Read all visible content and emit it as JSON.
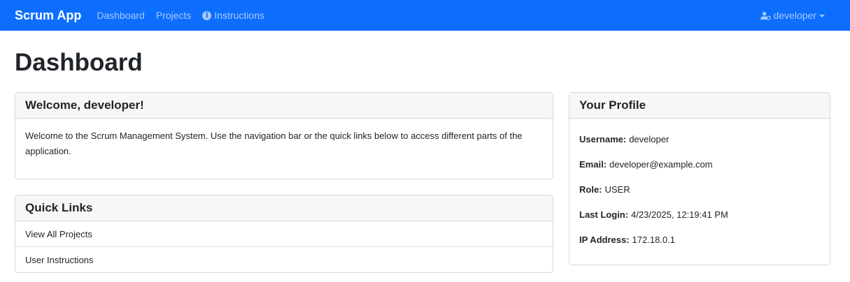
{
  "nav": {
    "brand": "Scrum App",
    "links": [
      "Dashboard",
      "Projects",
      "Instructions"
    ],
    "user": "developer"
  },
  "page": {
    "title": "Dashboard"
  },
  "welcome": {
    "title": "Welcome, developer!",
    "body": "Welcome to the Scrum Management System. Use the navigation bar or the quick links below to access different parts of the application."
  },
  "quick_links": {
    "title": "Quick Links",
    "items": [
      "View All Projects",
      "User Instructions"
    ]
  },
  "profile": {
    "title": "Your Profile",
    "fields": [
      {
        "label": "Username:",
        "value": "developer"
      },
      {
        "label": "Email:",
        "value": "developer@example.com"
      },
      {
        "label": "Role:",
        "value": "USER"
      },
      {
        "label": "Last Login:",
        "value": "4/23/2025, 12:19:41 PM"
      },
      {
        "label": "IP Address:",
        "value": "172.18.0.1"
      }
    ]
  },
  "colors": {
    "navbar": "#0d6efd",
    "header_bg": "#f7f7f7",
    "border": "#d7d7d7"
  }
}
